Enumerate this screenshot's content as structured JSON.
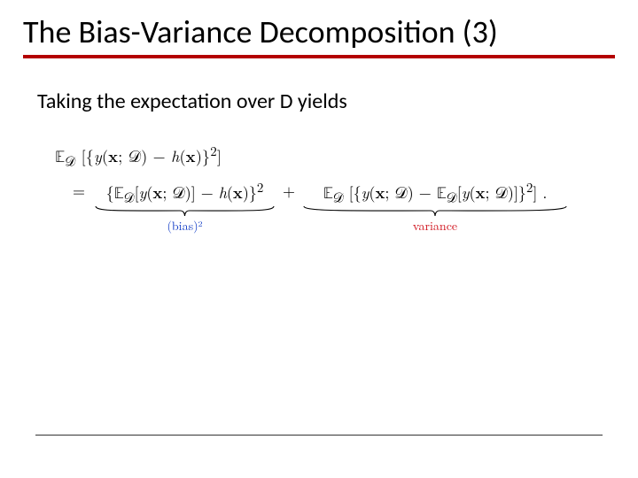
{
  "title": "The Bias-Variance Decomposition (3)",
  "body_text": "Taking the expectation over D yields",
  "equation": {
    "line1": "𝔼𝒟 [{y(x; 𝒟) − h(x)}²]",
    "eq_sign": "=",
    "bias_term": "{𝔼𝒟[y(x; 𝒟)] − h(x)}²",
    "plus": "+",
    "variance_term": "𝔼𝒟 [{y(x; 𝒟) − 𝔼𝒟[y(x; 𝒟)]}²] .",
    "bias_label": "(bias)²",
    "variance_label": "variance"
  }
}
